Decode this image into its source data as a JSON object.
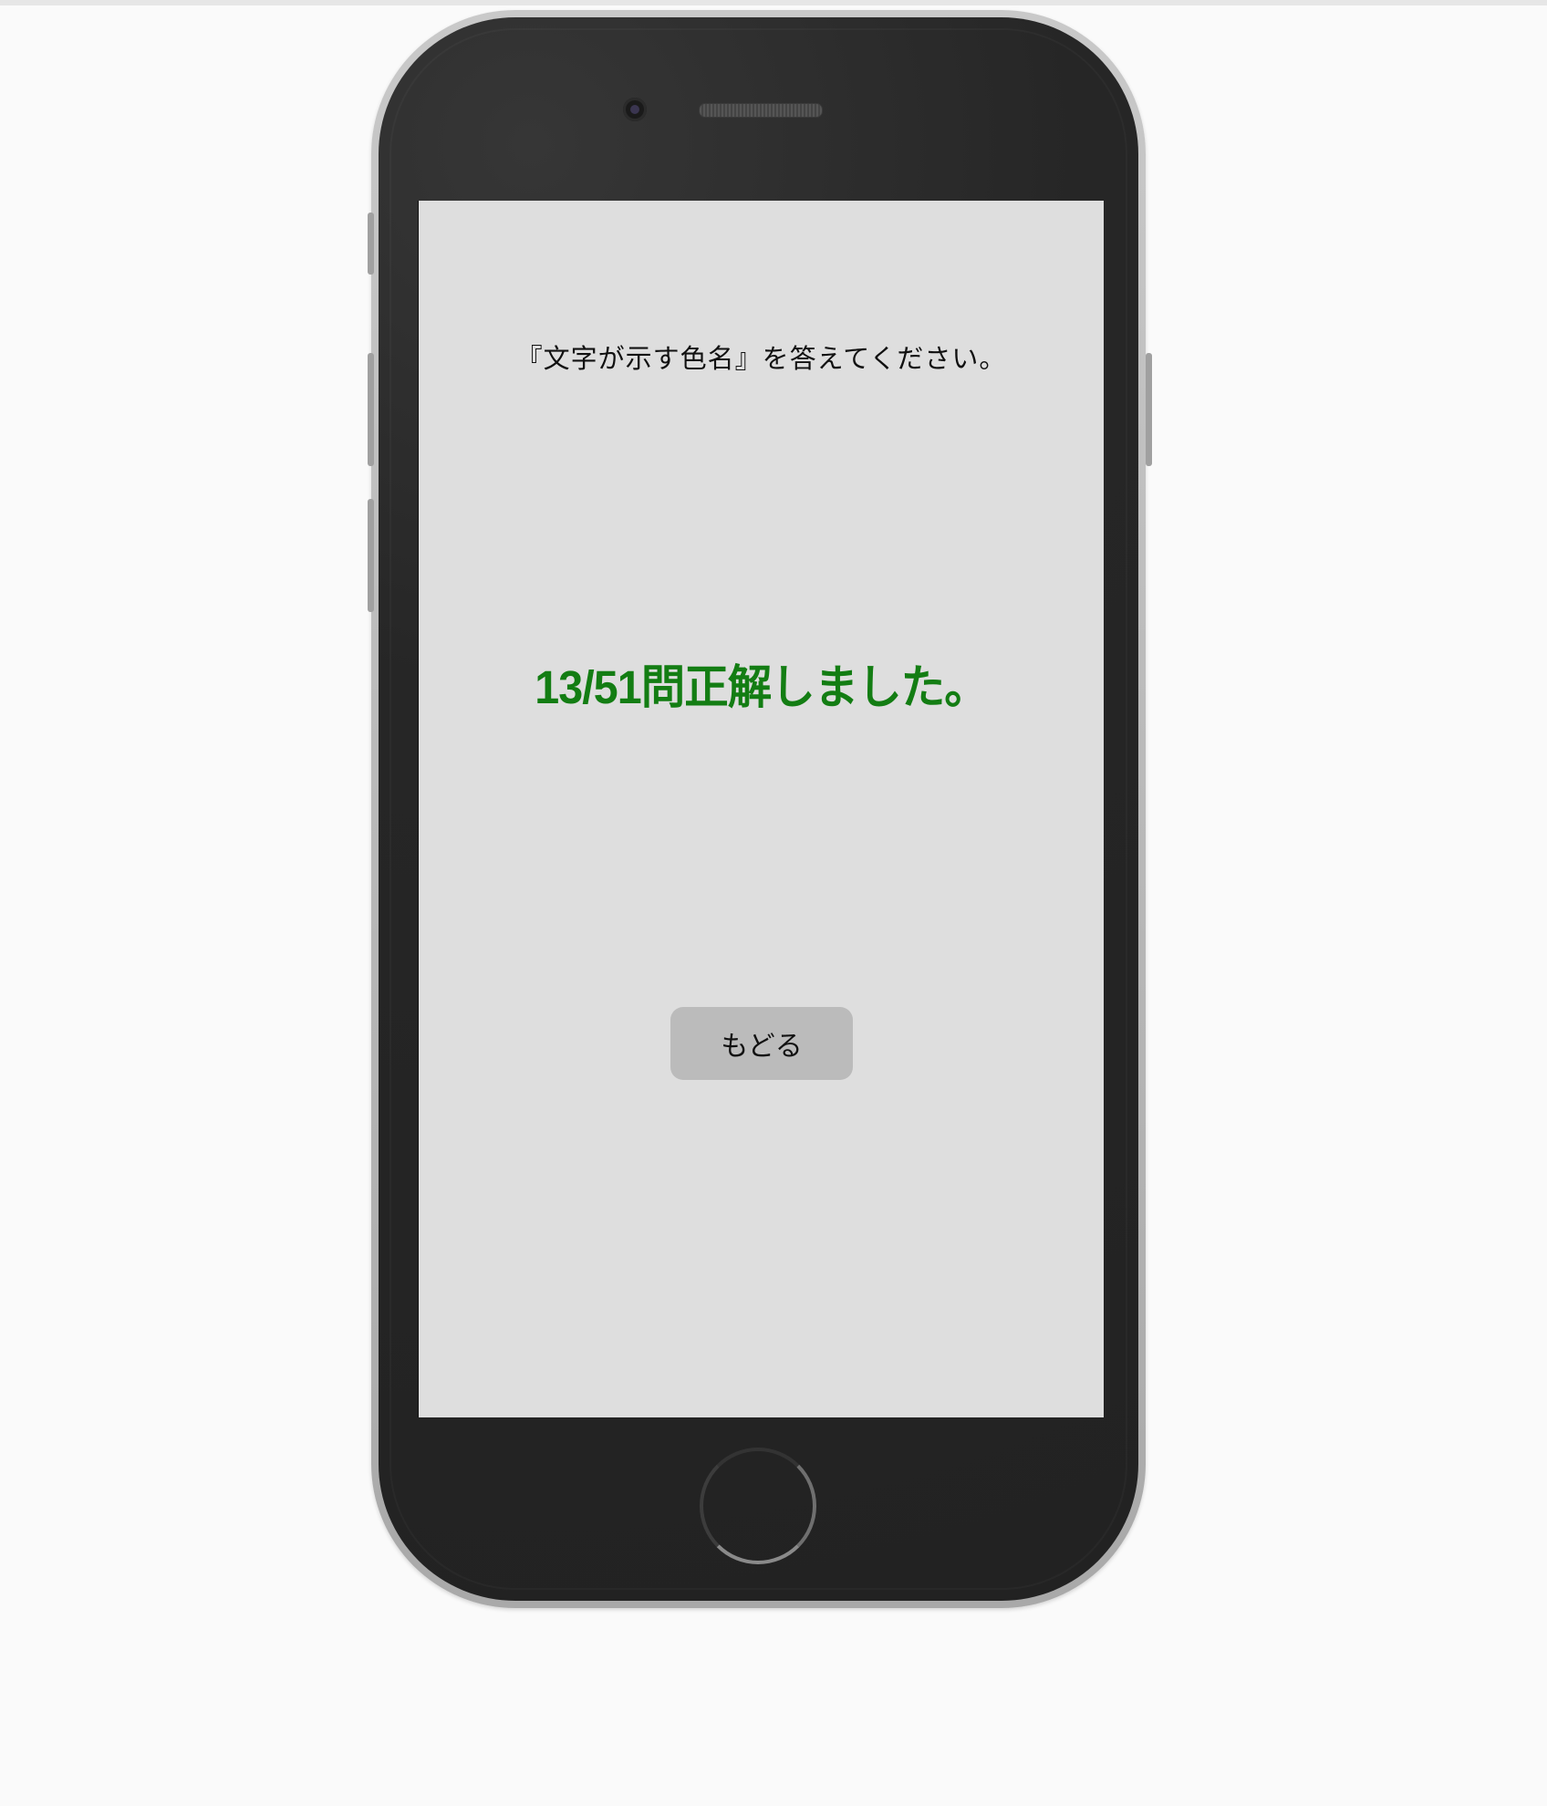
{
  "screen": {
    "instruction": "『文字が示す色名』を答えてください。",
    "result": "13/51問正解しました。",
    "back_button_label": "もどる"
  },
  "colors": {
    "result_text": "#137d13",
    "screen_background": "#dedede",
    "button_background": "#bbbbbb"
  }
}
